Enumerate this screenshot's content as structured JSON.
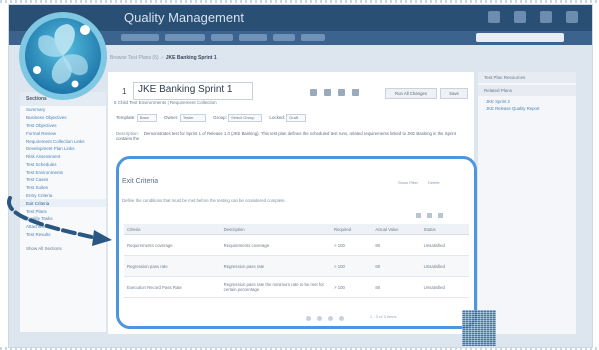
{
  "app": {
    "title": "Quality Management"
  },
  "breadcrumb": {
    "prefix": "Browse Test Plans (5)",
    "current": "JKE Banking Sprint 1"
  },
  "sidebar": {
    "header": "Sections",
    "items": [
      "Summary",
      "Business Objectives",
      "Test Objectives",
      "Formal Review",
      "Requirement Collection Links",
      "Development Plan Links",
      "Risk Assessment",
      "Test Schedules",
      "Test Environments",
      "Test Cases",
      "Test Suites",
      "Entry Criteria",
      "Exit Criteria",
      "Test Plans",
      "Quality Tasks",
      "Attachments",
      "Test Results"
    ],
    "footer": "Show All Sections"
  },
  "plan": {
    "number": "1",
    "title": "JKE Banking Sprint 1",
    "subtitle": "5 Child Test Environments | Requirement Collection",
    "fields": [
      {
        "label": "Template:",
        "value": "Base"
      },
      {
        "label": "Owner:",
        "value": "Tester"
      },
      {
        "label": "Group:",
        "value": "Select Group"
      },
      {
        "label": "Locked:",
        "value": "Draft"
      }
    ],
    "description_label": "Description:",
    "description": "Demonstrates test for Sprint 1 of Release 1.0 (JKE Banking). This test plan defines the scheduled test runs, related requirements linked to JKE Banking in the Sprint contains the"
  },
  "buttons": {
    "run": "Run All Changes",
    "save": "Save"
  },
  "exit_criteria": {
    "title": "Exit Criteria",
    "tools": [
      "Show Filter",
      "Delete"
    ],
    "description": "Define the conditions that must be met before the testing can be considered complete.",
    "columns": [
      "Criteria",
      "Description",
      "Required",
      "Actual Value",
      "Status"
    ],
    "rows": [
      [
        "Requirements coverage",
        "Requirements coverage",
        "> 100",
        "80",
        "Unsatisfied"
      ],
      [
        "Regression pass rate",
        "Regression pass rate",
        "> 100",
        "60",
        "Unsatisfied"
      ],
      [
        "Execution Record Pass Rate",
        "Regression pass rate the minimum rate to be met for certain percentage",
        "> 100",
        "80",
        "Unsatisfied"
      ]
    ],
    "pager_count": "1 - 3 of 3 items"
  },
  "right_panel": {
    "header": "Test Plan Resources",
    "subheader": "Related Plans",
    "links": [
      "JKE Sprint 2",
      "JKE Release Quality Report"
    ]
  },
  "colors": {
    "accent": "#4e95dd",
    "topbar": "#2a4f74",
    "link": "#4d83b7"
  },
  "icons": [
    "logo-icon",
    "arrow-icon",
    "qr-code-icon"
  ]
}
